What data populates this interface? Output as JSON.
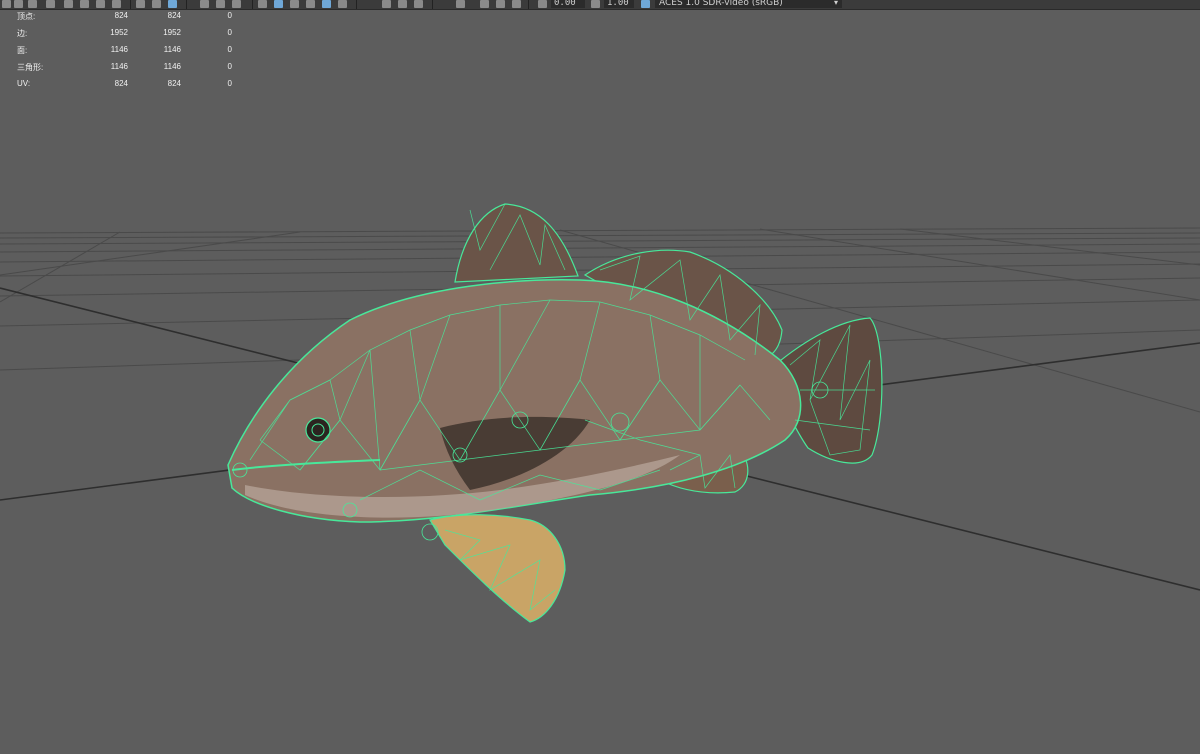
{
  "toolbar": {
    "exposure_value": "0.00",
    "gamma_value": "1.00",
    "colorspace": "ACES 1.0 SDR-video (sRGB)",
    "icons": [
      "select-icon",
      "move-icon",
      "rotate-icon",
      "scale-icon",
      "snap-icon",
      "grid-icon",
      "wireframe-icon",
      "shaded-icon",
      "textured-icon",
      "lights-icon",
      "shadows-icon",
      "camera-icon",
      "isolate-icon",
      "xray-icon",
      "colorspace-icon"
    ]
  },
  "hud": {
    "rows": [
      {
        "label": "顶点:",
        "a": "824",
        "b": "824",
        "c": "0"
      },
      {
        "label": "边:",
        "a": "1952",
        "b": "1952",
        "c": "0"
      },
      {
        "label": "面:",
        "a": "1146",
        "b": "1146",
        "c": "0"
      },
      {
        "label": "三角形:",
        "a": "1146",
        "b": "1146",
        "c": "0"
      },
      {
        "label": "UV:",
        "a": "824",
        "b": "824",
        "c": "0"
      }
    ]
  },
  "colors": {
    "viewport_bg": "#5d5d5d",
    "grid": "#4a4a4a",
    "grid_axis": "#2e2e2e",
    "wireframe": "#48e89a",
    "fish_body": "#8a7163",
    "fish_fin": "#6a5448",
    "pectoral_fin": "#c9a466"
  }
}
